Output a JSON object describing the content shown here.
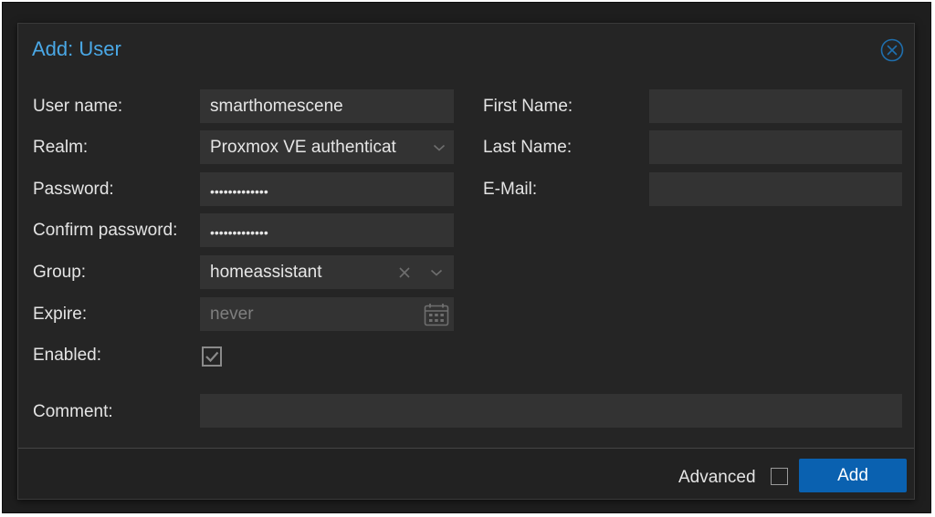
{
  "dialog": {
    "title": "Add: User",
    "close_icon": "close-circle-icon"
  },
  "form": {
    "user_name": {
      "label": "User name:",
      "value": "smarthomescene"
    },
    "realm": {
      "label": "Realm:",
      "value": "Proxmox VE authenticat"
    },
    "password": {
      "label": "Password:",
      "value": "•••••••••••••"
    },
    "confirm_password": {
      "label": "Confirm password:",
      "value": "•••••••••••••"
    },
    "group": {
      "label": "Group:",
      "value": "homeassistant"
    },
    "expire": {
      "label": "Expire:",
      "placeholder": "never"
    },
    "enabled": {
      "label": "Enabled:",
      "checked": true
    },
    "first_name": {
      "label": "First Name:",
      "value": ""
    },
    "last_name": {
      "label": "Last Name:",
      "value": ""
    },
    "email": {
      "label": "E-Mail:",
      "value": ""
    },
    "comment": {
      "label": "Comment:",
      "value": ""
    }
  },
  "footer": {
    "advanced_label": "Advanced",
    "advanced_checked": false,
    "add_label": "Add"
  },
  "colors": {
    "title": "#4aa8e6",
    "accent_button": "#0a61b0",
    "field_bg": "#333333",
    "dialog_bg": "#252525"
  }
}
